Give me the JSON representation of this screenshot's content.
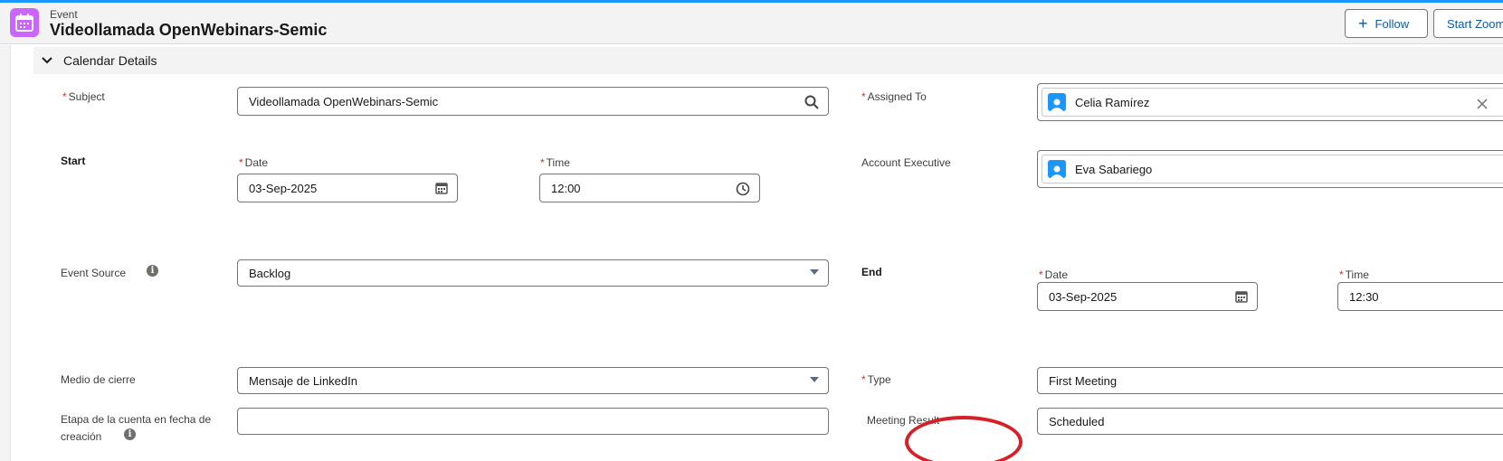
{
  "header": {
    "object_label": "Event",
    "record_title": "Videollamada OpenWebinars-Semic",
    "follow_label": "Follow",
    "start_zoom_label": "Start Zoom",
    "app_icon": "calendar-icon"
  },
  "section": {
    "title": "Calendar Details",
    "icon": "chevron-down-icon"
  },
  "fields": {
    "subject": {
      "label": "Subject",
      "value": "Videollamada OpenWebinars-Semic",
      "icon": "search-icon"
    },
    "assigned_to": {
      "label": "Assigned To",
      "value": "Celia Ramírez",
      "icon": "close-icon"
    },
    "start": {
      "label": "Start"
    },
    "start_date": {
      "label": "Date",
      "value": "03-Sep-2025",
      "icon": "calendar-icon"
    },
    "start_time": {
      "label": "Time",
      "value": "12:00",
      "icon": "clock-icon"
    },
    "account_executive": {
      "label": "Account Executive",
      "value": "Eva Sabariego"
    },
    "event_source": {
      "label": "Event Source",
      "value": "Backlog"
    },
    "end": {
      "label": "End"
    },
    "end_date": {
      "label": "Date",
      "value": "03-Sep-2025"
    },
    "end_time": {
      "label": "Time",
      "value": "12:30"
    },
    "medio_cierre": {
      "label": "Medio de cierre",
      "value": "Mensaje de LinkedIn"
    },
    "type": {
      "label": "Type",
      "value": "First Meeting"
    },
    "etapa_line1": {
      "label": "Etapa de la cuenta en fecha de"
    },
    "etapa_line2": {
      "label": "creación",
      "value": ""
    },
    "meeting_result": {
      "label": "Meeting Result",
      "value": "Scheduled"
    }
  },
  "required_mark": "*",
  "info_glyph": "i",
  "colors": {
    "accent": "#1b96ff",
    "app_icon_bg": "#cb65ff",
    "required": "#c23934",
    "annotation": "#d61f26",
    "button_text": "#0b5cab"
  }
}
